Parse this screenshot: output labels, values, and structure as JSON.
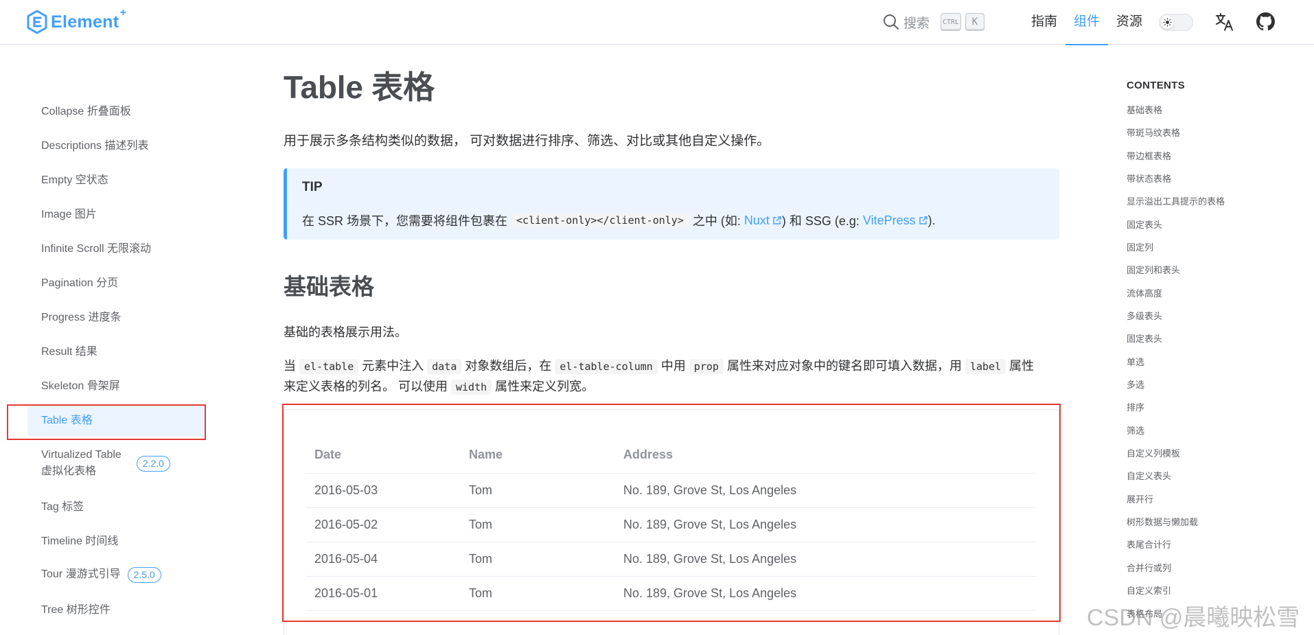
{
  "header": {
    "logo_text": "Element",
    "logo_plus": "+",
    "search_label": "搜索",
    "kbd_ctrl": "CTRL",
    "kbd_k": "K",
    "nav": [
      {
        "label": "指南",
        "active": false
      },
      {
        "label": "组件",
        "active": true
      },
      {
        "label": "资源",
        "active": false
      }
    ],
    "icons": [
      "search-icon",
      "sun-icon",
      "translate-icon",
      "github-icon"
    ]
  },
  "sidebar": {
    "items": [
      {
        "label": "Collapse 折叠面板"
      },
      {
        "label": "Descriptions 描述列表"
      },
      {
        "label": "Empty 空状态"
      },
      {
        "label": "Image 图片"
      },
      {
        "label": "Infinite Scroll 无限滚动"
      },
      {
        "label": "Pagination 分页"
      },
      {
        "label": "Progress 进度条"
      },
      {
        "label": "Result 结果"
      },
      {
        "label": "Skeleton 骨架屏"
      },
      {
        "label": "Table 表格",
        "active": true
      },
      {
        "label": "Virtualized Table 虚拟化表格",
        "line1": "Virtualized Table",
        "line2": "虚拟化表格",
        "badge": "2.2.0"
      },
      {
        "label": "Tag 标签"
      },
      {
        "label": "Timeline 时间线"
      },
      {
        "label": "Tour 漫游式引导",
        "badge": "2.5.0"
      },
      {
        "label": "Tree 树形控件"
      }
    ]
  },
  "main": {
    "title": "Table 表格",
    "lead": "用于展示多条结构类似的数据， 可对数据进行排序、筛选、对比或其他自定义操作。",
    "tip": {
      "title": "TIP",
      "text_before": "在 SSR 场景下，您需要将组件包裹在",
      "code": "<client-only></client-only>",
      "text_mid": "之中 (如:",
      "link1": "Nuxt",
      "text_mid2": ") 和 SSG (e.g:",
      "link2": "VitePress",
      "text_after": ")."
    },
    "section_title": "基础表格",
    "section_desc": "基础的表格展示用法。",
    "para": {
      "t1": "当",
      "c1": "el-table",
      "t2": "元素中注入",
      "c2": "data",
      "t3": "对象数组后，在",
      "c3": "el-table-column",
      "t4": "中用",
      "c4": "prop",
      "t5": "属性来对应对象中的键名即可填入数据，用",
      "c5": "label",
      "t6": "属性",
      "t7": "来定义表格的列名。 可以使用",
      "c6": "width",
      "t8": "属性来定义列宽。"
    },
    "table": {
      "columns": [
        "Date",
        "Name",
        "Address"
      ],
      "rows": [
        [
          "2016-05-03",
          "Tom",
          "No. 189, Grove St, Los Angeles"
        ],
        [
          "2016-05-02",
          "Tom",
          "No. 189, Grove St, Los Angeles"
        ],
        [
          "2016-05-04",
          "Tom",
          "No. 189, Grove St, Los Angeles"
        ],
        [
          "2016-05-01",
          "Tom",
          "No. 189, Grove St, Los Angeles"
        ]
      ]
    }
  },
  "toc": {
    "title": "CONTENTS",
    "items": [
      "基础表格",
      "带斑马纹表格",
      "带边框表格",
      "带状态表格",
      "显示溢出工具提示的表格",
      "固定表头",
      "固定列",
      "固定列和表头",
      "流体高度",
      "多级表头",
      "固定表头",
      "单选",
      "多选",
      "排序",
      "筛选",
      "自定义列模板",
      "自定义表头",
      "展开行",
      "树形数据与懒加载",
      "表尾合计行",
      "合并行或列",
      "自定义索引",
      "表格布局"
    ]
  },
  "watermark": "CSDN @晨曦映松雪",
  "colors": {
    "accent": "#409eff",
    "highlight": "#e53935"
  }
}
